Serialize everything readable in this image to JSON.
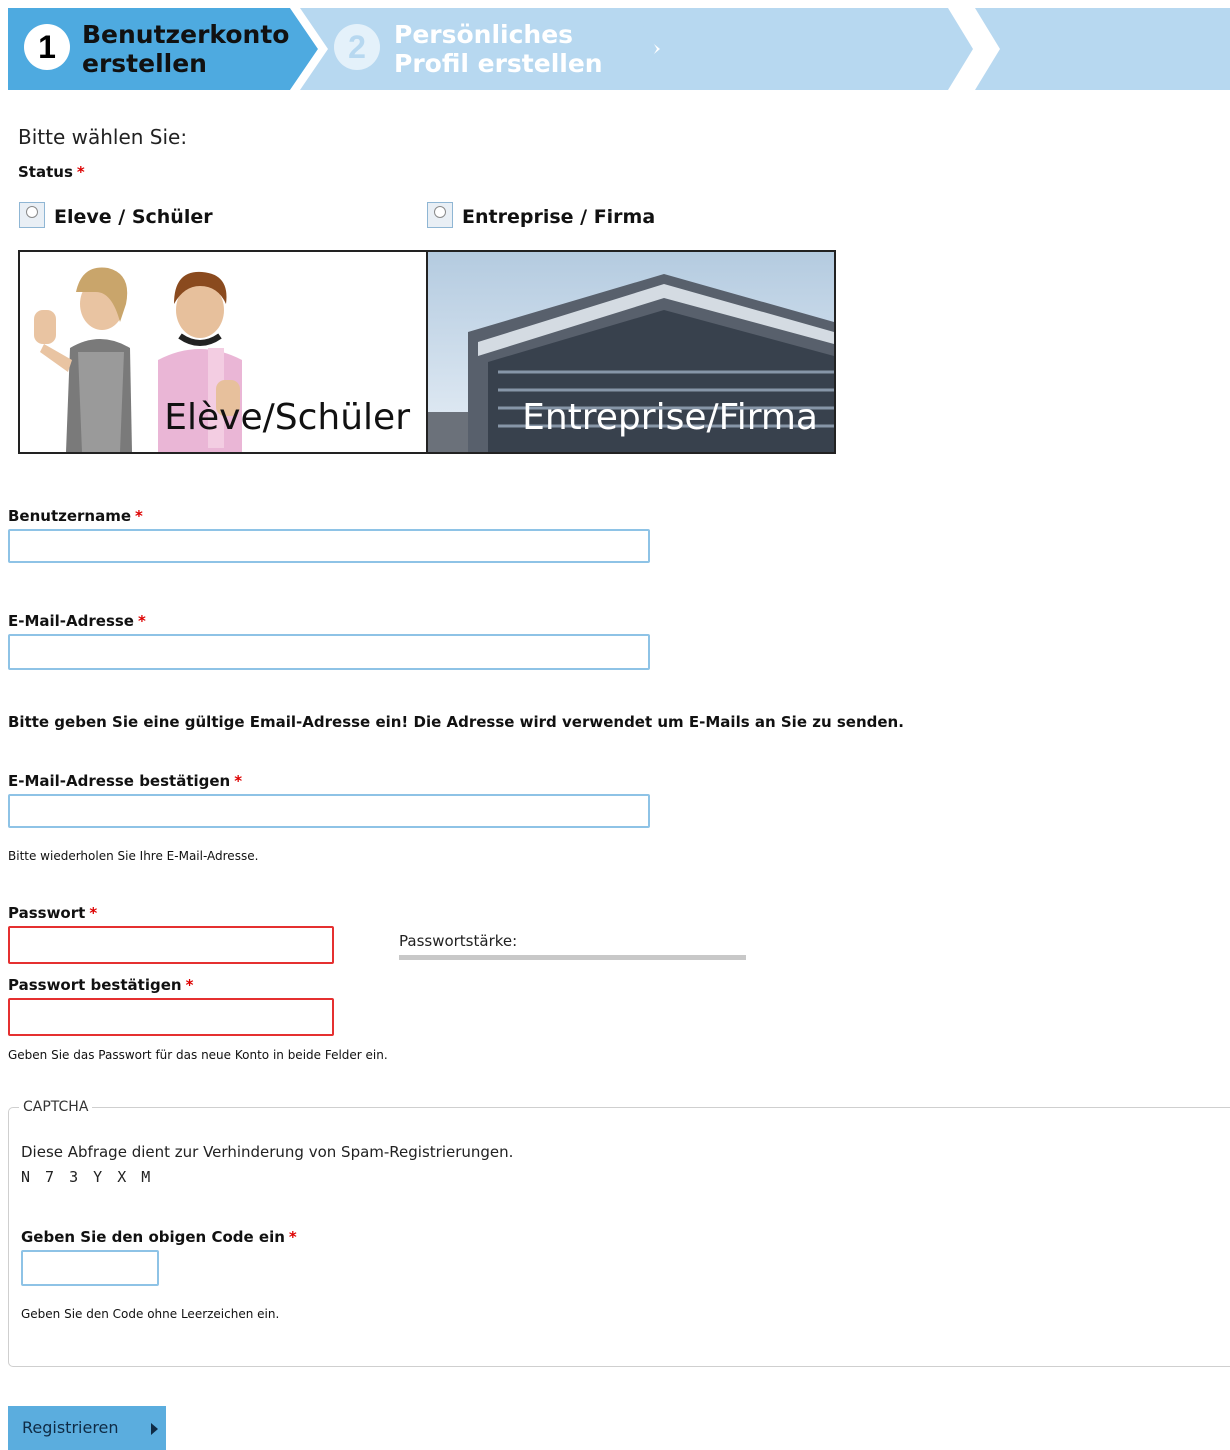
{
  "steps": [
    {
      "number": "1",
      "label_line1": "Benutzerkonto",
      "label_line2": "erstellen",
      "state": "active"
    },
    {
      "number": "2",
      "label_line1": "Persönliches",
      "label_line2": "Profil erstellen",
      "state": "inactive"
    }
  ],
  "colors": {
    "step_active": "#4eaae0",
    "step_inactive": "#b7d8f0",
    "input_border": "#8ec3e6",
    "input_invalid": "#e53030",
    "required": "#dd0000",
    "button": "#5badde"
  },
  "status": {
    "intro": "Bitte wählen Sie:",
    "label": "Status",
    "required_mark": "*",
    "options": [
      {
        "label": "Eleve / Schüler",
        "image_caption": "Elève/Schüler"
      },
      {
        "label": "Entreprise / Firma",
        "image_caption": "Entreprise/Firma"
      }
    ]
  },
  "form": {
    "username": {
      "label": "Benutzername",
      "required_mark": "*",
      "value": ""
    },
    "email": {
      "label": "E-Mail-Adresse",
      "required_mark": "*",
      "value": "",
      "note": "Bitte geben Sie eine gültige Email-Adresse ein! Die Adresse wird verwendet um E-Mails an Sie zu senden."
    },
    "email_confirm": {
      "label": "E-Mail-Adresse bestätigen",
      "required_mark": "*",
      "value": "",
      "note": "Bitte wiederholen Sie Ihre E-Mail-Adresse."
    },
    "password": {
      "label": "Passwort",
      "required_mark": "*",
      "value": ""
    },
    "password_strength_label": "Passwortstärke:",
    "password_confirm": {
      "label": "Passwort bestätigen",
      "required_mark": "*",
      "value": "",
      "note": "Geben Sie das Passwort für das neue Konto in beide Felder ein."
    }
  },
  "captcha": {
    "legend": "CAPTCHA",
    "description": "Diese Abfrage dient zur Verhinderung von Spam-Registrierungen.",
    "code": "N 7 3 Y X M",
    "input_label": "Geben Sie den obigen Code ein",
    "required_mark": "*",
    "value": "",
    "note": "Geben Sie den Code ohne Leerzeichen ein."
  },
  "submit": {
    "label": "Registrieren"
  }
}
